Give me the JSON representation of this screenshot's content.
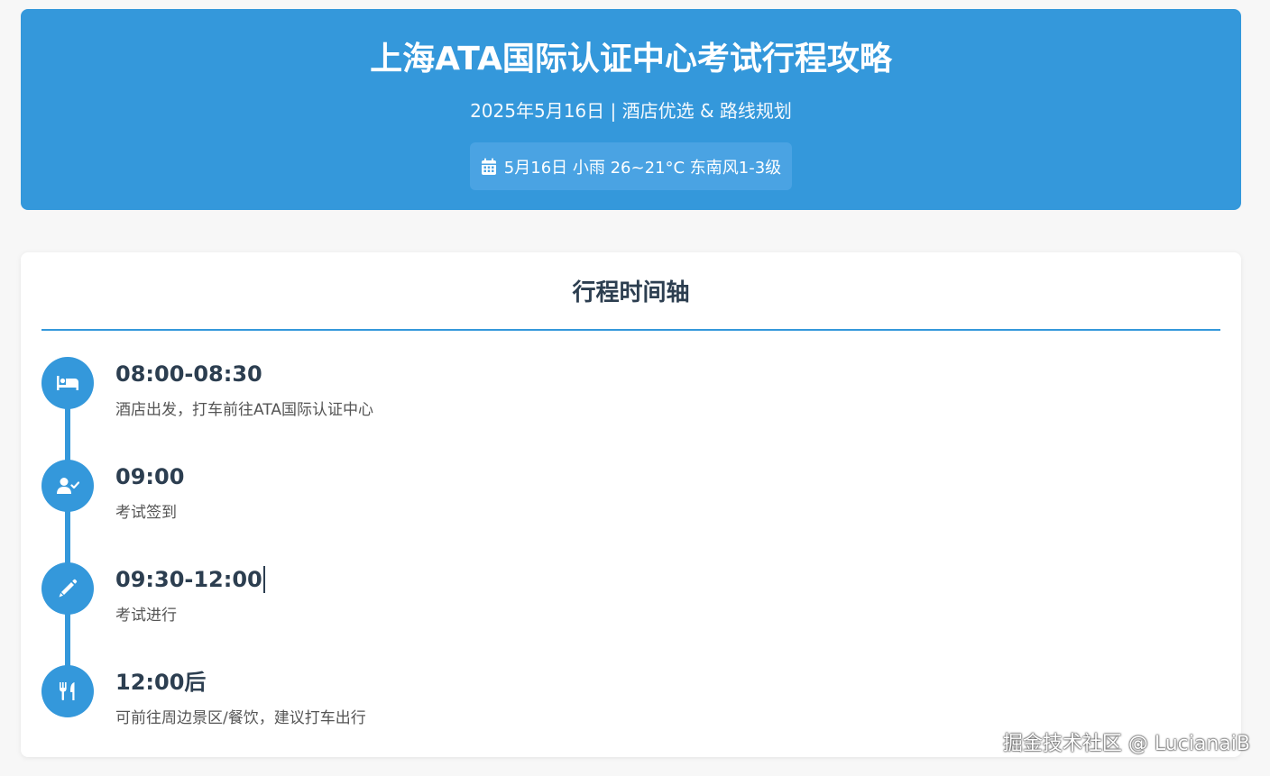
{
  "header": {
    "title": "上海ATA国际认证中心考试行程攻略",
    "subtitle": "2025年5月16日 | 酒店优选 & 路线规划",
    "weather": {
      "icon": "calendar-icon",
      "text": "5月16日 小雨 26~21°C 东南风1-3级"
    }
  },
  "timeline": {
    "title": "行程时间轴",
    "items": [
      {
        "time": "08:00-08:30",
        "description": "酒店出发，打车前往ATA国际认证中心",
        "icon": "bed-icon"
      },
      {
        "time": "09:00",
        "description": "考试签到",
        "icon": "user-check-icon"
      },
      {
        "time": "09:30-12:00",
        "description": "考试进行",
        "icon": "pencil-icon"
      },
      {
        "time": "12:00后",
        "description": "可前往周边景区/餐饮，建议打车出行",
        "icon": "utensils-icon"
      }
    ]
  },
  "watermark": "掘金技术社区 @ LucianaiB",
  "colors": {
    "accent": "#3498db",
    "text": "#2c3e50",
    "muted": "#555555",
    "background": "#f7f7f7"
  }
}
